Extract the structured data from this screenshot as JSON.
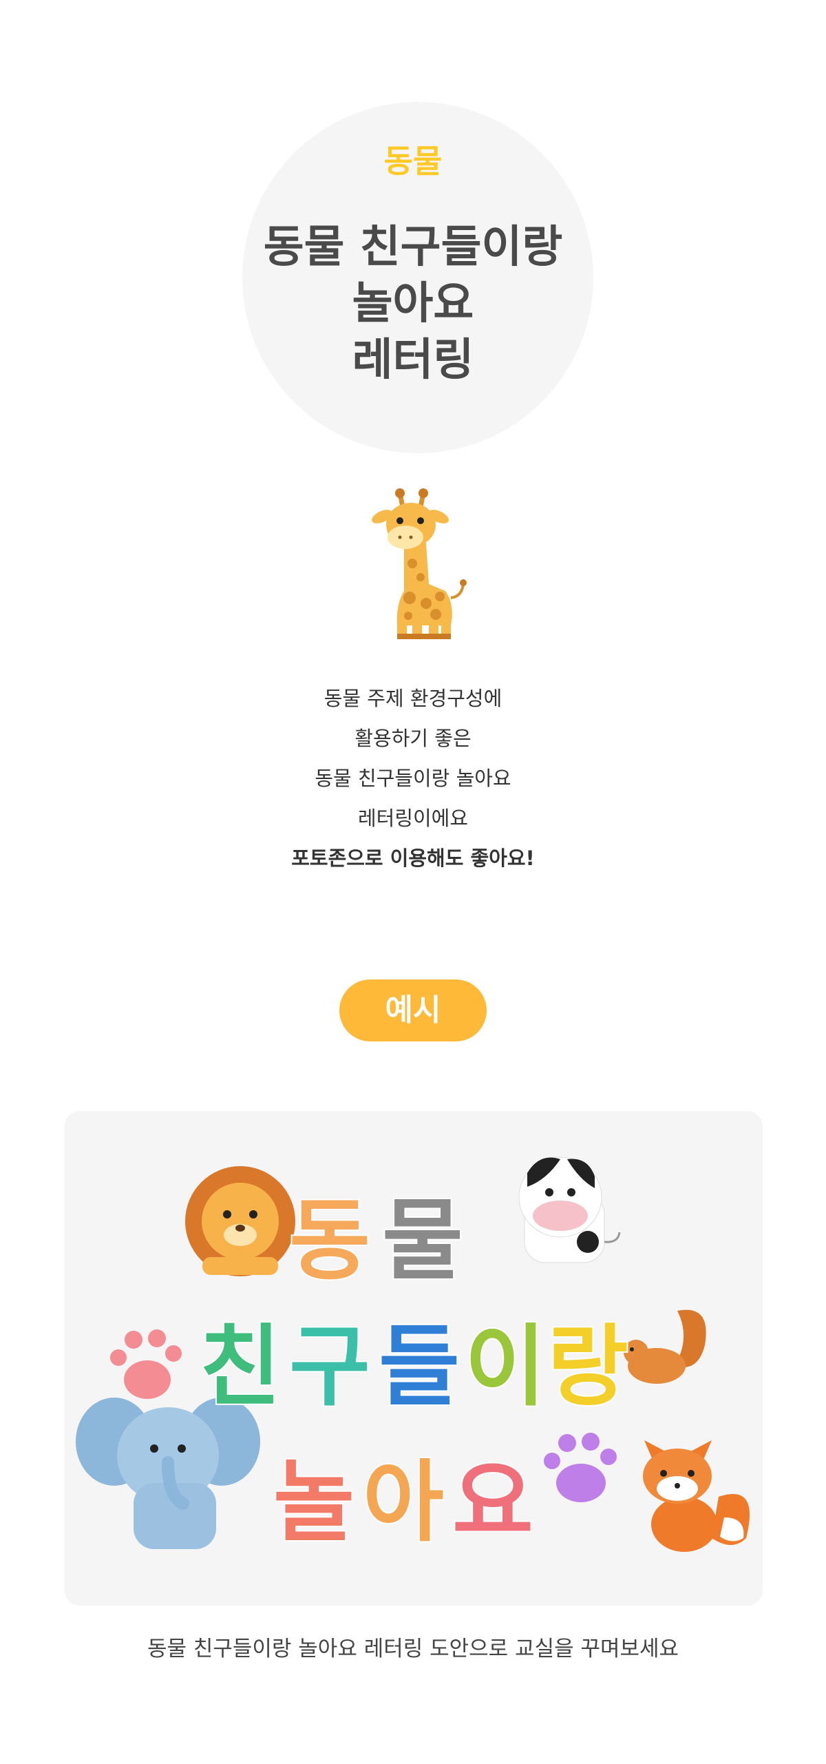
{
  "header": {
    "category": "동물",
    "title_lines": [
      "동물 친구들이랑",
      "놀아요",
      "레터링"
    ]
  },
  "description": {
    "lines": [
      "동물 주제 환경구성에",
      "활용하기 좋은",
      "동물 친구들이랑 놀아요",
      "레터링이에요",
      "포토존으로 이용해도 좋아요!"
    ]
  },
  "example": {
    "label": "예시",
    "lettering": {
      "row1": [
        "동",
        "물"
      ],
      "row2": [
        "친",
        "구",
        "들",
        "이",
        "랑"
      ],
      "row3": [
        "놀",
        "아",
        "요"
      ]
    },
    "colors": {
      "row1": [
        "#f6a95a",
        "#8a8a8a"
      ],
      "row2": [
        "#3ebd7c",
        "#3bbfa8",
        "#2f7fd6",
        "#9ac63b",
        "#f4cf2a"
      ],
      "row3": [
        "#f27a66",
        "#f4a652",
        "#ef6f7a"
      ]
    }
  },
  "caption": "동물 친구들이랑 놀아요 레터링 도안으로 교실을 꾸며보세요",
  "icons": [
    "giraffe-icon",
    "lion-icon",
    "cow-icon",
    "paw-icon",
    "squirrel-icon",
    "elephant-icon",
    "fox-icon"
  ],
  "accent": {
    "yellow": "#ffc928",
    "pill": "#ffb938"
  }
}
